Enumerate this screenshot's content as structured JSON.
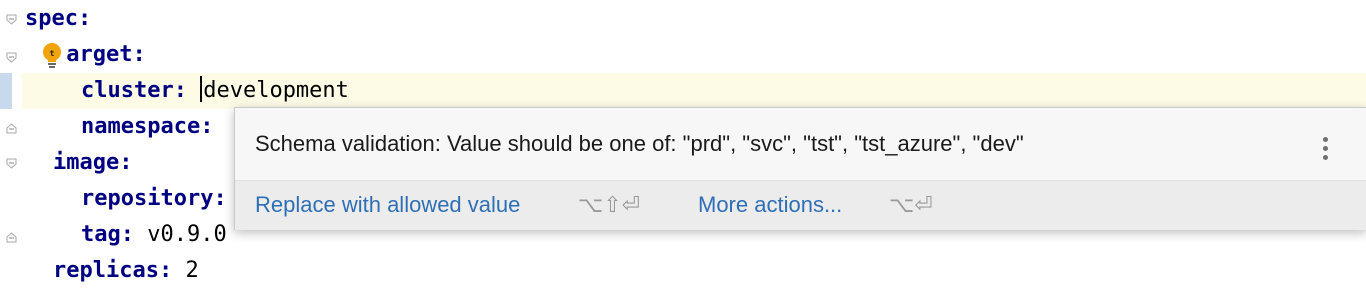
{
  "editor": {
    "lines": [
      {
        "key": "spec",
        "sep": ":",
        "value": ""
      },
      {
        "key": "target",
        "sep": ":",
        "value": ""
      },
      {
        "key": "cluster",
        "sep": ": ",
        "value": "development"
      },
      {
        "key": "namespace",
        "sep": ":",
        "value": ""
      },
      {
        "key": "image",
        "sep": ":",
        "value": ""
      },
      {
        "key": "repository",
        "sep": ":",
        "value": ""
      },
      {
        "key": "tag",
        "sep": ": ",
        "value": "v0.9.0"
      },
      {
        "key": "replicas",
        "sep": ": ",
        "value": "2"
      }
    ],
    "target_first_letter": "t",
    "target_rest": "arget"
  },
  "popup": {
    "message": "Schema validation: Value should be one of: \"prd\", \"svc\", \"tst\", \"tst_azure\", \"dev\"",
    "primary_action": "Replace with allowed value",
    "primary_shortcut": "⌥⇧⏎",
    "more_actions": "More actions...",
    "more_shortcut": "⌥⏎"
  },
  "colors": {
    "key": "#000080",
    "link": "#2f6fb5",
    "current_line": "#fdfbe6",
    "bulb": "#f0a30a"
  }
}
